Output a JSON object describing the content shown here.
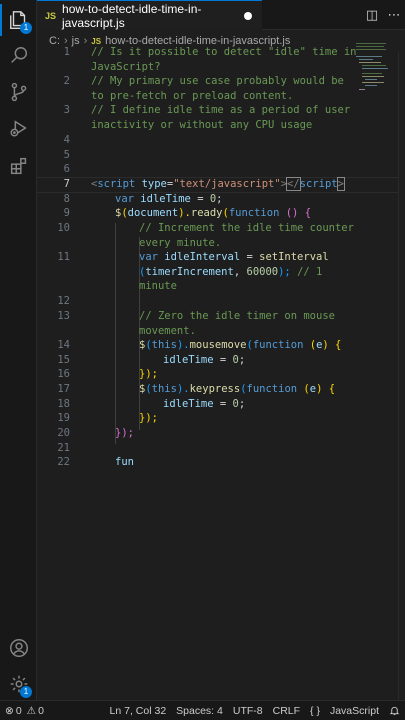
{
  "tab": {
    "file_type": "JS",
    "filename": "how-to-detect-idle-time-in-javascript.js"
  },
  "breadcrumb": {
    "drive": "C:",
    "folder": "js",
    "file_type": "JS",
    "file": "how-to-detect-idle-time-in-javascript.js"
  },
  "activity_bar": {
    "explorer_badge": "1",
    "settings_badge": "1"
  },
  "editor": {
    "active_line": 7,
    "lines": [
      {
        "num": "1",
        "wrapped": true
      },
      {
        "num": "2",
        "wrapped": true
      },
      {
        "num": "3",
        "wrapped": true
      },
      {
        "num": "4"
      },
      {
        "num": "5"
      },
      {
        "num": "6"
      },
      {
        "num": "7"
      },
      {
        "num": "8"
      },
      {
        "num": "9"
      },
      {
        "num": "10",
        "wrapped": true
      },
      {
        "num": "11",
        "wrapped": true
      },
      {
        "num": "12"
      },
      {
        "num": "13",
        "wrapped": true
      },
      {
        "num": "14"
      },
      {
        "num": "15"
      },
      {
        "num": "16"
      },
      {
        "num": "17"
      },
      {
        "num": "18"
      },
      {
        "num": "19"
      },
      {
        "num": "20"
      },
      {
        "num": "21"
      },
      {
        "num": "22"
      }
    ],
    "code": {
      "l1a": "// Is it possible to detect \"idle\" time in",
      "l1b": "JavaScript?",
      "l2a": "// My primary use case probably would be",
      "l2b": "to pre-fetch or preload content.",
      "l3a": "// I define idle time as a period of user",
      "l3b": "inactivity or without any CPU usage",
      "l7_open": "<",
      "l7_tag": "script",
      "l7_attr": "type",
      "l7_eq": "=",
      "l7_str": "\"text/javascript\"",
      "l7_gt": ">",
      "l7_close_lt": "</",
      "l7_close_tag": "script",
      "l7_close_gt": ">",
      "l8_kw": "var",
      "l8_var": "idleTime",
      "l8_rest": " = ",
      "l8_num": "0",
      "l8_end": ";",
      "l9_fn": "$",
      "l9_p1": "(",
      "l9_var": "document",
      "l9_p2": ").",
      "l9_fn2": "ready",
      "l9_p3": "(",
      "l9_kw": "function",
      "l9_p4": " () {",
      "l10a": "// Increment the idle time counter",
      "l10b": "every minute.",
      "l11_kw": "var",
      "l11_var": "idleInterval",
      "l11_eq": " = ",
      "l11_fn": "setInterval",
      "l11b_p": "(",
      "l11b_var": "timerIncrement",
      "l11b_sep": ", ",
      "l11b_num": "60000",
      "l11b_end": "); ",
      "l11b_com": "// 1",
      "l11c_com": "minute",
      "l13a": "// Zero the idle timer on mouse",
      "l13b": "movement.",
      "l14_fn": "$",
      "l14_p1": "(",
      "l14_kw": "this",
      "l14_p2": ").",
      "l14_fn2": "mousemove",
      "l14_p3": "(",
      "l14_kw2": "function",
      "l14_p4": " (",
      "l14_var": "e",
      "l14_p5": ") {",
      "l15_var": "idleTime",
      "l15_rest": " = ",
      "l15_num": "0",
      "l15_end": ";",
      "l16": "});",
      "l17_fn": "$",
      "l17_p1": "(",
      "l17_kw": "this",
      "l17_p2": ").",
      "l17_fn2": "keypress",
      "l17_p3": "(",
      "l17_kw2": "function",
      "l17_p4": " (",
      "l17_var": "e",
      "l17_p5": ") {",
      "l18_var": "idleTime",
      "l18_rest": " = ",
      "l18_num": "0",
      "l18_end": ";",
      "l19": "});",
      "l20": "});",
      "l22": "fun"
    }
  },
  "statusbar": {
    "errors": "0",
    "warnings": "0",
    "position": "Ln 7, Col 32",
    "spaces": "Spaces: 4",
    "encoding": "UTF-8",
    "eol": "CRLF",
    "braces": "{ }",
    "language": "JavaScript"
  },
  "colors": {
    "accent": "#0078d4",
    "comment": "#6a9955",
    "keyword": "#569cd6",
    "variable": "#9cdcfe",
    "function": "#dcdcaa",
    "number": "#b5cea8",
    "string": "#ce9178",
    "js_badge": "#cbcb41"
  }
}
